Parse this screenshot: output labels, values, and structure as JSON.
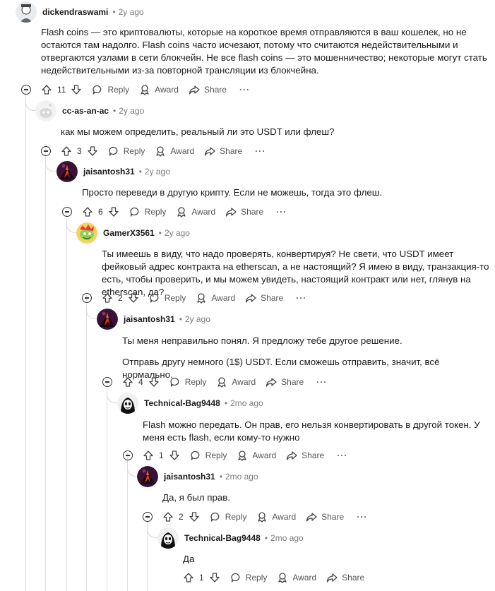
{
  "labels": {
    "reply": "Reply",
    "award": "Award",
    "share": "Share",
    "more": "···"
  },
  "comments": [
    {
      "author": "dickendraswami",
      "time": "2y ago",
      "votes": "11",
      "paragraphs": [
        "Flash coins — это криптовалюты, которые на короткое время отправляются в ваш кошелек, но не остаются там надолго. Flash coins часто исчезают, потому что считаются недействительными и отвергаются узлами в сети блокчейн. Не все flash coins — это мошенничество; некоторые могут стать недействительными из-за повторной трансляции из блокчейна."
      ]
    },
    {
      "author": "cc-as-an-ac",
      "time": "2y ago",
      "votes": "3",
      "paragraphs": [
        "как мы можем определить, реальный ли это USDT или флеш?"
      ]
    },
    {
      "author": "jaisantosh31",
      "time": "2y ago",
      "votes": "6",
      "paragraphs": [
        "Просто переведи в другую крипту. Если не можешь, тогда это флеш."
      ]
    },
    {
      "author": "GamerX3561",
      "time": "2y ago",
      "votes": "2",
      "paragraphs": [
        "Ты имеешь в виду, что надо проверять, конвертируя? Не свети, что USDT имеет фейковый адрес контракта на etherscan, а не настоящий? Я имею в виду, транзакция-то есть, чтобы проверить, и мы можем увидеть, настоящий контракт или нет, глянув на etherscan, да?"
      ]
    },
    {
      "author": "jaisantosh31",
      "time": "2y ago",
      "votes": "4",
      "paragraphs": [
        "Ты меня неправильно понял. Я предложу тебе другое решение.",
        "Отправь другу немного (1$) USDT. Если сможешь отправить, значит, всё нормально."
      ]
    },
    {
      "author": "Technical-Bag9448",
      "time": "2mo ago",
      "votes": "1",
      "paragraphs": [
        "Flash можно передать. Он прав, его нельзя конвертировать в другой токен. У меня есть flash, если кому-то нужно"
      ]
    },
    {
      "author": "jaisantosh31",
      "time": "2mo ago",
      "votes": "2",
      "paragraphs": [
        "Да, я был прав."
      ]
    },
    {
      "author": "Technical-Bag9448",
      "time": "2mo ago",
      "votes": "1",
      "paragraphs": [
        "Да"
      ]
    }
  ]
}
